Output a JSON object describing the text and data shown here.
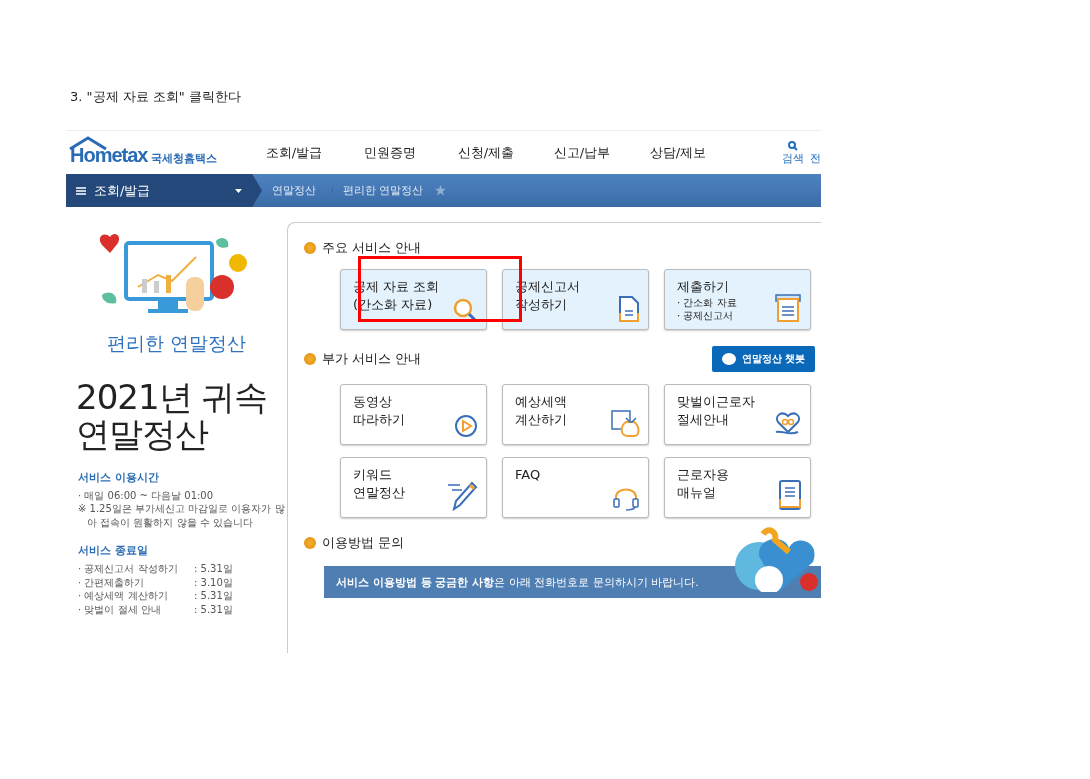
{
  "caption": "3. \"공제 자료 조회\" 클릭한다",
  "logo": {
    "wordmark": "Hometax",
    "name": "국세청홈택스"
  },
  "nav": [
    "조회/발급",
    "민원증명",
    "신청/제출",
    "신고/납부",
    "상담/제보"
  ],
  "header_actions": [
    {
      "kind": "search",
      "label": "검색"
    },
    {
      "kind": "text",
      "label": "전"
    }
  ],
  "menu": {
    "label": "조회/발급"
  },
  "breadcrumb": [
    "연말정산",
    "편리한 연말정산"
  ],
  "sidebar": {
    "subtitle": "편리한 연말정산",
    "title_lines": [
      "2021년 귀속",
      "연말정산"
    ],
    "hours": {
      "heading": "서비스 이용시간",
      "items": [
        "· 매일 06:00 ~ 다음날 01:00"
      ],
      "note": "※ 1.25일은 부가세신고 마감일로 이용자가 많아 접속이 원활하지 않을 수 있습니다"
    },
    "end_dates": {
      "heading": "서비스 종료일",
      "rows": [
        {
          "label": "· 공제신고서 작성하기",
          "date": ": 5.31일"
        },
        {
          "label": "· 간편제출하기",
          "date": ": 3.10일"
        },
        {
          "label": "· 예상세액 계산하기",
          "date": ": 5.31일"
        },
        {
          "label": "· 맞벌이 절세 안내",
          "date": ": 5.31일"
        }
      ]
    }
  },
  "sections": [
    {
      "title": "주요 서비스 안내",
      "cards": [
        {
          "lines": [
            "공제 자료 조회",
            "(간소화 자료)"
          ],
          "kind": "magnifier",
          "tinted": true,
          "highlighted": true
        },
        {
          "lines": [
            "공제신고서",
            "작성하기"
          ],
          "kind": "document",
          "tinted": true,
          "highlighted": false
        },
        {
          "lines": [
            "제출하기"
          ],
          "bullets": [
            "· 간소화 자료",
            "· 공제신고서"
          ],
          "kind": "tray",
          "tinted": true,
          "highlighted": false
        }
      ]
    },
    {
      "title": "부가 서비스 안내",
      "action": "연말정산 챗봇",
      "cards": [
        {
          "lines": [
            "동영상",
            "따라하기"
          ],
          "kind": "play",
          "tinted": false,
          "highlighted": false
        },
        {
          "lines": [
            "예상세액",
            "계산하기"
          ],
          "kind": "moneybag",
          "tinted": false,
          "highlighted": false
        },
        {
          "lines": [
            "맞벌이근로자",
            "절세안내"
          ],
          "kind": "heart-hand",
          "tinted": false,
          "highlighted": false
        },
        {
          "lines": [
            "키워드",
            "연말정산"
          ],
          "kind": "pencil",
          "tinted": false,
          "highlighted": false
        },
        {
          "lines": [
            "FAQ"
          ],
          "kind": "headset",
          "tinted": false,
          "highlighted": false
        },
        {
          "lines": [
            "근로자용",
            "매뉴얼"
          ],
          "kind": "tablet",
          "tinted": false,
          "highlighted": false
        }
      ]
    },
    {
      "title": "이용방법 문의",
      "banner": "**서비스 이용방법 등 궁금한 사항**은 아래 전화번호로 문의하시기 바랍니다."
    }
  ]
}
